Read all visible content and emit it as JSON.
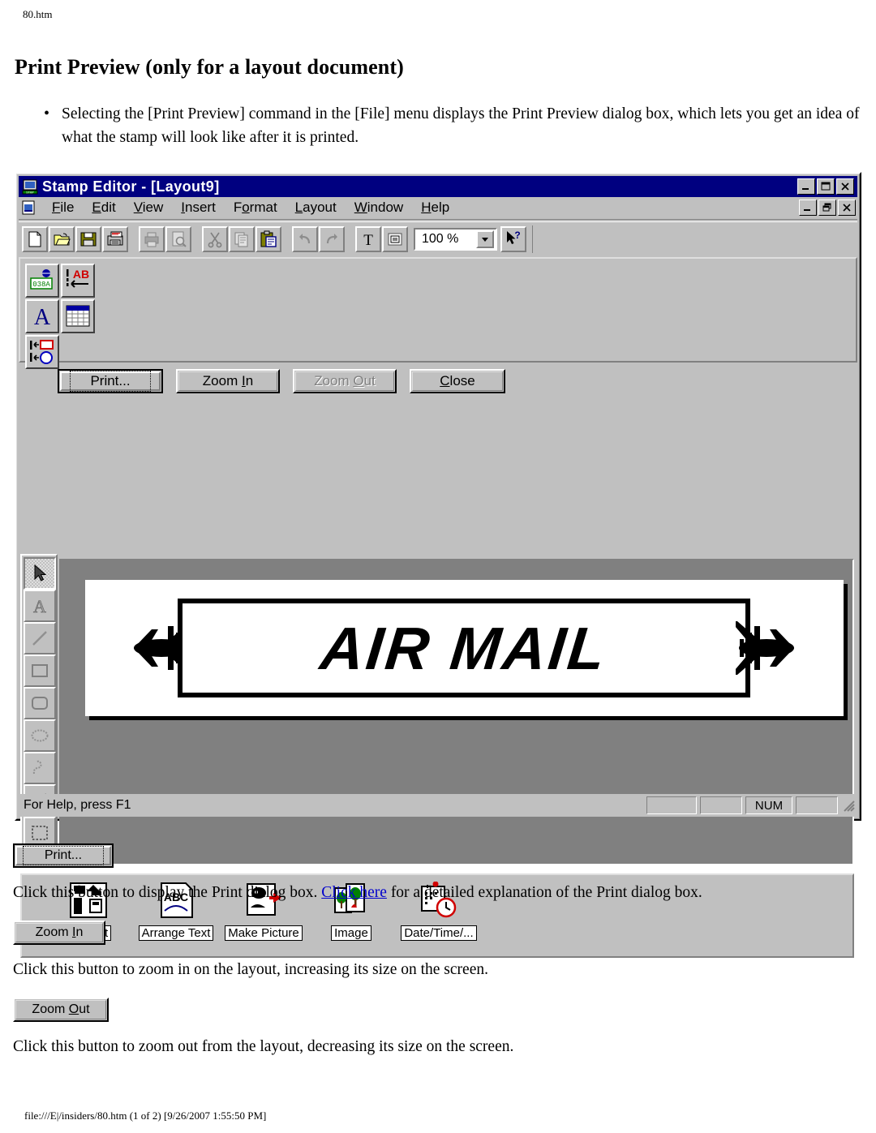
{
  "document": {
    "filename": "80.htm",
    "title": "Print Preview (only for a layout document)",
    "bullet": "Selecting the [Print Preview] command in the [File] menu displays the Print Preview dialog box, which lets you get an idea of what the stamp will look like after it is printed.",
    "footer": "file:///E|/insiders/80.htm (1 of 2) [9/26/2007 1:55:50 PM]"
  },
  "window": {
    "title": "Stamp Editor - [Layout9]",
    "title_buttons": [
      "minimize",
      "maximize",
      "close"
    ],
    "mdi_buttons": [
      "minimize",
      "restore",
      "close"
    ],
    "menu": [
      {
        "label": "File",
        "accel": "F"
      },
      {
        "label": "Edit",
        "accel": "E"
      },
      {
        "label": "View",
        "accel": "V"
      },
      {
        "label": "Insert",
        "accel": "I"
      },
      {
        "label": "Format",
        "accel": "o"
      },
      {
        "label": "Layout",
        "accel": "L"
      },
      {
        "label": "Window",
        "accel": "W"
      },
      {
        "label": "Help",
        "accel": "H"
      }
    ],
    "toolbar_icons": [
      "new-document-icon",
      "open-folder-icon",
      "save-disk-icon",
      "print-label-icon",
      "print-icon",
      "print-preview-icon",
      "cut-scissors-icon",
      "copy-icon",
      "paste-icon",
      "undo-icon",
      "redo-icon",
      "text-tool-icon",
      "frame-tool-icon"
    ],
    "zoom": {
      "value": "100 %",
      "arrow": "chevron-down-icon"
    },
    "help_cursor_icon": "help-pointer-icon",
    "object_bar_icons": [
      "barcode-icon",
      "ab-text-direction-icon",
      "font-A-icon",
      "table-icon",
      "align-objects-icon"
    ],
    "preview_buttons": [
      {
        "label": "Print...",
        "accel": "",
        "state": "default",
        "name": "print-button"
      },
      {
        "label": "Zoom In",
        "accel": "I",
        "state": "normal",
        "name": "zoom-in-button"
      },
      {
        "label": "Zoom Out",
        "accel": "O",
        "state": "disabled",
        "name": "zoom-out-button"
      },
      {
        "label": "Close",
        "accel": "C",
        "state": "normal",
        "name": "close-button"
      }
    ],
    "tool_palette": [
      "select-arrow-tool",
      "text-tool",
      "line-tool",
      "rectangle-tool",
      "rounded-rectangle-tool",
      "ellipse-tool",
      "freehand-tool",
      "polygon-tool",
      "marquee-select-tool"
    ],
    "preview_stamp_text": "AIR MAIL",
    "bottom_bar": [
      {
        "label": "Clip Art",
        "icon": "clip-art-icon"
      },
      {
        "label": "Arrange Text",
        "icon": "arrange-text-icon"
      },
      {
        "label": "Make Picture",
        "icon": "make-picture-icon"
      },
      {
        "label": "Image",
        "icon": "image-icon"
      },
      {
        "label": "Date/Time/...",
        "icon": "date-time-icon"
      }
    ],
    "status": {
      "text": "For Help, press F1",
      "panels": [
        "",
        "",
        "NUM",
        ""
      ],
      "grip": "resize-grip-icon"
    },
    "colors": {
      "titlebar": "#000080",
      "face": "#c0c0c0",
      "canvas": "#808080",
      "shadow": "#808080",
      "highlight": "#ffffff"
    }
  },
  "explanations": [
    {
      "button_label": "Print...",
      "button_state": "default",
      "text_before": "Click this button to display the Print dialog box. ",
      "link_text": "Click here",
      "text_after": " for a detailed explanation of the Print dialog box."
    },
    {
      "button_label": "Zoom In",
      "button_accel": "I",
      "button_state": "normal",
      "text_before": "Click this button to zoom in on the layout, increasing its size on the screen.",
      "link_text": "",
      "text_after": ""
    },
    {
      "button_label": "Zoom Out",
      "button_accel": "O",
      "button_state": "normal",
      "text_before": "Click this button to zoom out from the layout, decreasing its size on the screen.",
      "link_text": "",
      "text_after": ""
    }
  ]
}
